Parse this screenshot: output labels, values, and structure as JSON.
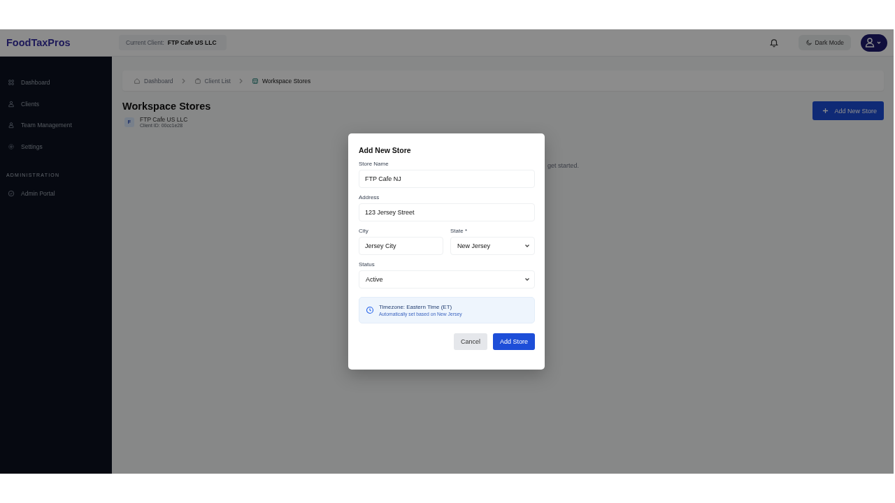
{
  "header": {
    "logo": "FoodTaxPros",
    "client_label": "Current Client:",
    "client_name": "FTP Cafe US LLC",
    "theme_button": "Dark Mode"
  },
  "sidebar": {
    "items": [
      {
        "label": "Dashboard"
      },
      {
        "label": "Clients"
      },
      {
        "label": "Team Management"
      },
      {
        "label": "Settings"
      }
    ],
    "section_label": "ADMINISTRATION",
    "admin_items": [
      {
        "label": "Admin Portal"
      }
    ]
  },
  "breadcrumbs": [
    {
      "label": "Dashboard",
      "current": false
    },
    {
      "label": "Client List",
      "current": false
    },
    {
      "label": "Workspace Stores",
      "current": true
    }
  ],
  "page": {
    "title": "Workspace Stores",
    "client_initial": "F",
    "client_name": "FTP Cafe US LLC",
    "client_id": "Client ID: 00cc1e28",
    "add_button": "Add New Store",
    "empty_text": "get started."
  },
  "modal": {
    "title": "Add New Store",
    "field_rows": [
      [
        {
          "label": "Store Name",
          "value": "FTP Cafe NJ",
          "kind": "text"
        }
      ],
      [
        {
          "label": "Address",
          "value": "123 Jersey Street",
          "kind": "text"
        }
      ],
      [
        {
          "label": "City",
          "value": "Jersey City",
          "kind": "text"
        },
        {
          "label": "State *",
          "value": "New Jersey",
          "kind": "select"
        }
      ],
      [
        {
          "label": "Status",
          "value": "Active",
          "kind": "select"
        }
      ]
    ],
    "notice": {
      "title": "Timezone: Eastern Time (ET)",
      "text": "Automatically set based on New Jersey"
    },
    "buttons": [
      {
        "label": "Cancel",
        "kind": "secondary"
      },
      {
        "label": "Add Store",
        "kind": "primary"
      }
    ]
  }
}
